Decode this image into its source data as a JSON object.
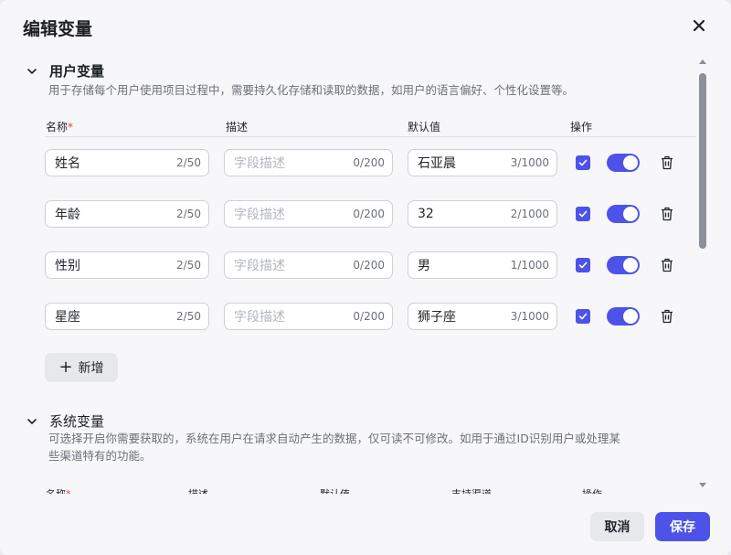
{
  "dialog": {
    "title": "编辑变量"
  },
  "user_section": {
    "title": "用户变量",
    "description": "用于存储每个用户使用项目过程中，需要持久化存储和读取的数据，如用户的语言偏好、个性化设置等。",
    "columns": {
      "name": "名称",
      "required_mark": "*",
      "desc": "描述",
      "default": "默认值",
      "ops": "操作"
    },
    "rows": [
      {
        "name": "姓名",
        "name_count": "2/50",
        "desc_placeholder": "字段描述",
        "desc_count": "0/200",
        "default": "石亚晨",
        "default_count": "3/1000",
        "checked": true,
        "enabled": true
      },
      {
        "name": "年龄",
        "name_count": "2/50",
        "desc_placeholder": "字段描述",
        "desc_count": "0/200",
        "default": "32",
        "default_count": "2/1000",
        "checked": true,
        "enabled": true
      },
      {
        "name": "性别",
        "name_count": "2/50",
        "desc_placeholder": "字段描述",
        "desc_count": "0/200",
        "default": "男",
        "default_count": "1/1000",
        "checked": true,
        "enabled": true
      },
      {
        "name": "星座",
        "name_count": "2/50",
        "desc_placeholder": "字段描述",
        "desc_count": "0/200",
        "default": "狮子座",
        "default_count": "3/1000",
        "checked": true,
        "enabled": true
      }
    ],
    "add_label": "新增"
  },
  "system_section": {
    "title": "系统变量",
    "description_line1": "可选择开启你需要获取的，系统在用户在请求自动产生的数据，仅可读不可修改。如用于通过ID识别用户或处理某",
    "description_line2": "些渠道特有的功能。",
    "columns": {
      "name": "名称",
      "required_mark": "*",
      "desc": "描述",
      "default": "默认值",
      "channel": "支持渠道",
      "ops": "操作"
    }
  },
  "footer": {
    "cancel_label": "取消",
    "save_label": "保存"
  },
  "colors": {
    "accent": "#4d53e8",
    "required": "#e63946"
  }
}
